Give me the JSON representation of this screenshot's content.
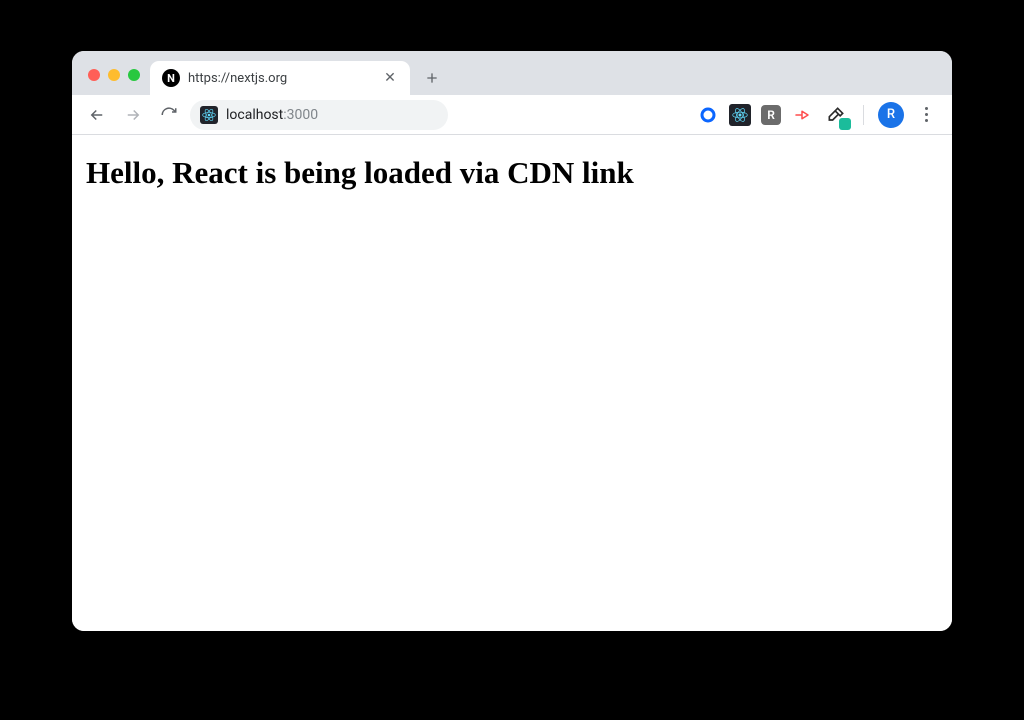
{
  "window": {
    "traffic_lights": {
      "close": "#ff5f57",
      "minimize": "#febc2e",
      "zoom": "#28c840"
    }
  },
  "tabstrip": {
    "tabs": [
      {
        "favicon_letter": "N",
        "title": "https://nextjs.org",
        "active": true
      }
    ],
    "new_tab_label": "+"
  },
  "toolbar": {
    "back_enabled": true,
    "forward_enabled": false,
    "url_host": "localhost",
    "url_port": ":3000",
    "extensions": [
      {
        "name": "circle-blue-icon"
      },
      {
        "name": "react-devtools-icon"
      },
      {
        "name": "r-badge-icon",
        "letter": "R"
      },
      {
        "name": "red-arrow-icon"
      },
      {
        "name": "color-picker-icon"
      }
    ],
    "profile_letter": "R"
  },
  "page": {
    "heading": "Hello, React is being loaded via CDN link"
  }
}
